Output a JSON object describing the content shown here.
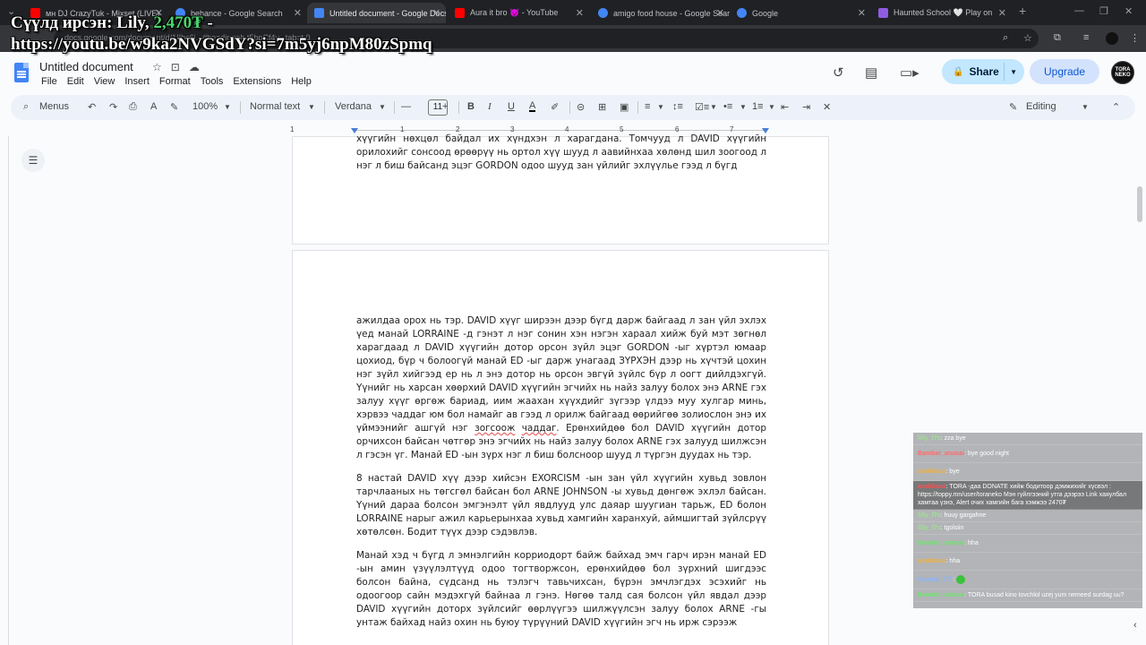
{
  "browser": {
    "tabs": [
      {
        "title": "мн DJ CrazyTuk - Mixset (LIVE)",
        "fav_color": "#ff0000"
      },
      {
        "title": "behance - Google Search",
        "fav_color": "#4285f4"
      },
      {
        "title": "Untitled document - Google Docs",
        "fav_color": "#4285f4",
        "active": true
      },
      {
        "title": "Aura it bro 😈 - YouTube",
        "fav_color": "#ff0000"
      },
      {
        "title": "amigo food house - Google Search",
        "fav_color": "#4285f4"
      },
      {
        "title": "Google",
        "fav_color": "#4285f4"
      },
      {
        "title": "Haunted School 🤍 Play on",
        "fav_color": "#8e5ce0"
      }
    ],
    "url": "docs.google.com/document/d/1IIbs6j...#heading=h.t5bpCf4v...tab=t.0",
    "new_tab": "+",
    "close_glyph": "✕"
  },
  "overlay": {
    "line1_prefix": "Сүүлд ирсэн: Lily, ",
    "line1_amount": "2,470₮",
    "line1_suffix": " -",
    "line2": "https://youtu.be/w9ka2NVGSdY?si=7m5yj6npM80zSpmq"
  },
  "docs": {
    "title": "Untitled document",
    "menu": [
      "File",
      "Edit",
      "View",
      "Insert",
      "Format",
      "Tools",
      "Extensions",
      "Help"
    ],
    "share_label": "Share",
    "upgrade_label": "Upgrade",
    "avatar_text": "TORA NEKO"
  },
  "toolbar": {
    "menus_label": "Menus",
    "zoom": "100%",
    "style": "Normal text",
    "font": "Verdana",
    "font_size": "11",
    "mode": "Editing"
  },
  "ruler": {
    "ticks": [
      "1",
      "1",
      "2",
      "3",
      "4",
      "5",
      "6",
      "7"
    ]
  },
  "document": {
    "page1": [
      "хүүгийн нөхцөл байдал их хүндхэн л харагдана. Томчууд л DAVID хүүгийн орилохийг сонсоод өрөөрүү нь ортол хүү шууд л аавийнхаа хөлөнд шил зоогоод л нэг л биш байсанд эцэг GORDON одоо шууд зан үйлийг эхлүүлье гээд л бүгд"
    ],
    "page2_p1_before": "ажилдаа орох нь тэр. DAVID хүүг ширээн дээр бүгд дарж байгаад л зан үйл эхлэх үед манай LORRAINE -д гэнэт л нэг сонин хэн нэгэн хараал хийж буй мэт зөгнөл харагдаад л DAVID хүүгийн дотор орсон зүйл эцэг GORDON -ыг хүртэл юмаар цохиод, бүр ч болоогүй манай ED -ыг дарж унагаад ЗҮРХЭН дээр нь хүчтэй цохин нэг зүйл хийгээд ер нь л энэ дотор нь орсон эвгүй зүйлс бүр л оогт дийлдэхгүй. Үүнийг нь харсан хөөрхий DAVID хүүгийн эгчийх нь найз залуу болох энэ ARNE гэх залуу хүүг өргөж бариад, иим жаахан хүүхдийг зүгээр үлдээ муу хулгар минь, хэрвээ чаддаг юм бол намайг ав гээд л орилж байгаад өөрийгөө золиослон энэ их үймээнийг ашгүй нэг ",
    "page2_p1_sq1": "зогсоож",
    "page2_p1_mid": " ",
    "page2_p1_sq2": "чаддаг",
    "page2_p1_after": ". Ерөнхийдөө бол DAVID хүүгийн дотор орчихсон байсан чөтгөр энэ эгчийх нь найз залуу болох ARNE гэх залууд шилжсэн л гэсэн үг. Манай ED -ын зүрх нэг л биш болсноор шууд л түргэн дуудах нь тэр.",
    "page2_p2": "8 настай DAVID хүү дээр хийсэн EXORCISM -ын зан үйл хүүгийн хувьд зовлон тарчлааных нь төгсгөл байсан бол ARNE JOHNSON -ы хувьд дөнгөж эхлэл байсан. Үүний дараа болсон эмгэнэлт үйл явдлууд улс даяар шуугиан тарьж, ED болон LORRAINE нарыг ажил карьерынхаа хувьд хамгийн харанхуй, аймшигтай зүйлсрүү хөтөлсөн. Бодит түүх дээр сэдэвлэв.",
    "page2_p3": "Манай хэд ч бүгд л эмнэлгийн корриодорт байж байхад эмч гарч ирэн манай ED -ын амин үзүүлэлтүүд одоо тогтворжсон, ерөнхийдөө бол зүрхний шигдээс болсон байна, сүдсанд нь тэлэгч тавьчихсан, бүрэн эмчлэгдэх эсэхийг нь одоогоор сайн мэдэхгүй байнаа л гэнэ. Нөгөө талд сая болсон үйл явдал дээр DAVID хүүгийн доторх зүйлсийг өөрлүүгээ шилжүүлсэн залуу болох ARNE -гы унтаж байхад найз охин нь буюу түрүүний DAVID хүүгийн эгч нь ирж сэрээж"
  },
  "chat": {
    "messages": [
      {
        "user": "lilly_f7s",
        "text": "zza bye",
        "color": "#9be28f"
      },
      {
        "user": "Bambar_anuxai",
        "text": "bye good night",
        "color": "#ff6b6b"
      },
      {
        "user": "amikkaaa",
        "text": "bye",
        "color": "#f3b13d"
      },
      {
        "user": "amikkaaa",
        "text": "TORA -даа DONATE хийж бодитоор дэмжихийг хүсвэл : https://toppy.mn/user/toraneko Мэн гүйлгээний утга дээрээ Link хаяулбал хамтаа үзнэ, Alert очих хамгийн бага хэмжээ 2470₮",
        "color": "#ff4d4d",
        "highlight": true
      },
      {
        "user": "lilly_f7s",
        "text": "huuy gargahne",
        "color": "#9be28f"
      },
      {
        "user": "lilly_f7s",
        "text": "tgolsiin",
        "color": "#9be28f"
      },
      {
        "user": "Bambar_anuxai",
        "text": "hha",
        "color": "#6fe36f"
      },
      {
        "user": "amikkaaa",
        "text": "hha",
        "color": "#f3b13d"
      },
      {
        "user": "Nomuk_777",
        "text": "",
        "color": "#8ab4f8",
        "emoji": true
      },
      {
        "user": "Bambar_anuxai",
        "text": "TORA busad kino tovchlol uzej yum nemeed surdag uu?",
        "color": "#6fe36f"
      }
    ]
  }
}
